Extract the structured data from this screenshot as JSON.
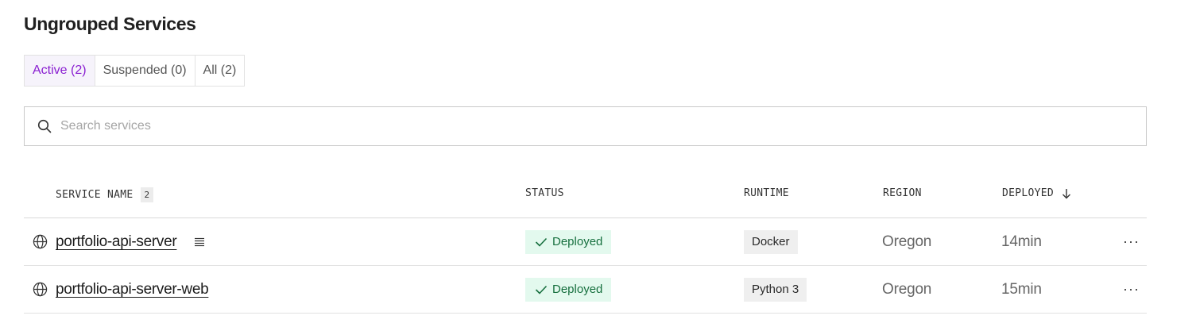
{
  "page": {
    "title": "Ungrouped Services"
  },
  "tabs": [
    {
      "label": "Active (2)",
      "active": true
    },
    {
      "label": "Suspended (0)",
      "active": false
    },
    {
      "label": "All (2)",
      "active": false
    }
  ],
  "search": {
    "placeholder": "Search services",
    "value": "",
    "icon": "search-icon"
  },
  "table": {
    "columns": {
      "service_name": "SERVICE NAME",
      "service_count": "2",
      "status": "STATUS",
      "runtime": "RUNTIME",
      "region": "REGION",
      "deployed": "DEPLOYED",
      "sort_icon": "arrow-down-icon"
    },
    "rows": [
      {
        "name": "portfolio-api-server",
        "type_icon": "globe-icon",
        "has_logs": true,
        "status": "Deployed",
        "runtime": "Docker",
        "region": "Oregon",
        "deployed": "14min",
        "more": "···"
      },
      {
        "name": "portfolio-api-server-web",
        "type_icon": "globe-icon",
        "has_logs": false,
        "status": "Deployed",
        "runtime": "Python 3",
        "region": "Oregon",
        "deployed": "15min",
        "more": "···"
      }
    ]
  },
  "colors": {
    "accent": "#8a1fd1",
    "active_tab_bg": "#f6f3fb",
    "status_ok_bg": "#e3f9ee",
    "status_ok_text": "#17703f"
  }
}
